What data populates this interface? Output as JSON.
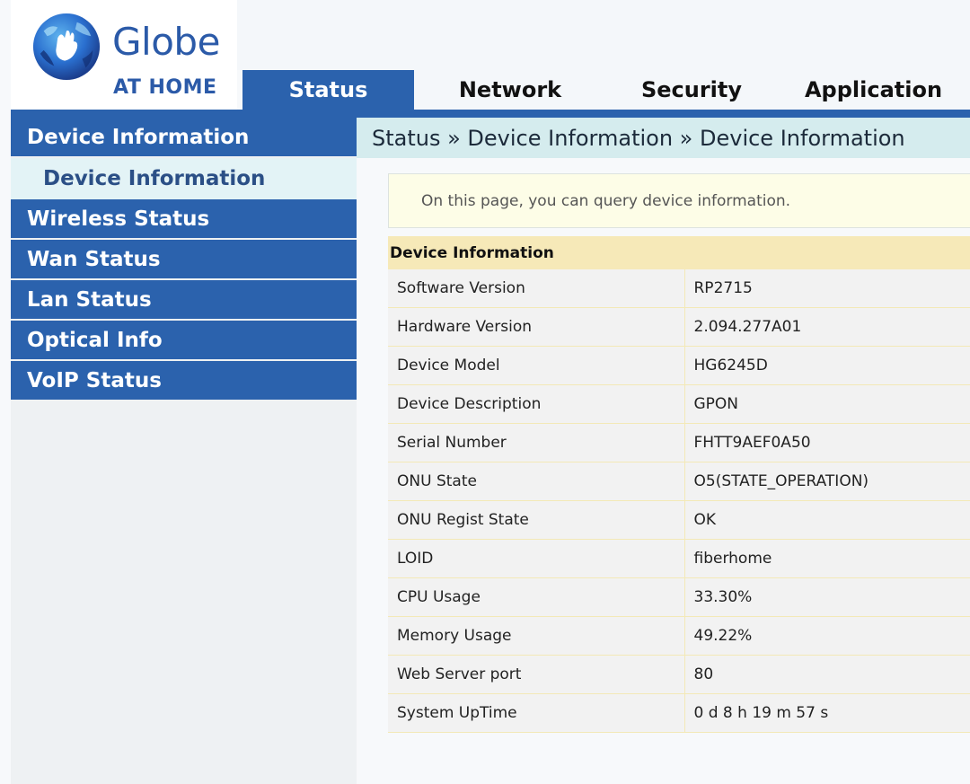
{
  "brand": {
    "name": "Globe",
    "tagline": "AT HOME"
  },
  "nav": {
    "tabs": [
      {
        "label": "Status",
        "active": true
      },
      {
        "label": "Network",
        "active": false
      },
      {
        "label": "Security",
        "active": false
      },
      {
        "label": "Application",
        "active": false
      }
    ]
  },
  "sidebar": {
    "items": [
      {
        "label": "Device Information"
      },
      {
        "label": "Device Information"
      },
      {
        "label": "Wireless Status"
      },
      {
        "label": "Wan Status"
      },
      {
        "label": "Lan Status"
      },
      {
        "label": "Optical Info"
      },
      {
        "label": "VoIP Status"
      }
    ]
  },
  "main": {
    "breadcrumb": "Status » Device Information » Device Information",
    "notice": "On this page, you can query device information.",
    "table": {
      "title": "Device Information",
      "rows": [
        {
          "key": "Software Version",
          "value": "RP2715"
        },
        {
          "key": "Hardware Version",
          "value": "2.094.277A01"
        },
        {
          "key": "Device Model",
          "value": "HG6245D"
        },
        {
          "key": "Device Description",
          "value": "GPON"
        },
        {
          "key": "Serial Number",
          "value": "FHTT9AEF0A50"
        },
        {
          "key": "ONU State",
          "value": "O5(STATE_OPERATION)"
        },
        {
          "key": "ONU Regist State",
          "value": "OK"
        },
        {
          "key": "LOID",
          "value": "fiberhome"
        },
        {
          "key": "CPU Usage",
          "value": "33.30%"
        },
        {
          "key": "Memory Usage",
          "value": "49.22%"
        },
        {
          "key": "Web Server port",
          "value": "80"
        },
        {
          "key": "System UpTime",
          "value": "0 d 8 h 19 m 57 s"
        }
      ]
    }
  },
  "colors": {
    "primary_blue": "#2b62ad",
    "brand_blue": "#2b5aa8",
    "breadcrumb_bg": "#d5ecee",
    "submenu_bg": "#e3f3f6",
    "table_header_bg": "#f6e9b8",
    "notice_bg": "#fdfde7"
  },
  "icons": {
    "logo": "globe-hand-logo-icon"
  }
}
